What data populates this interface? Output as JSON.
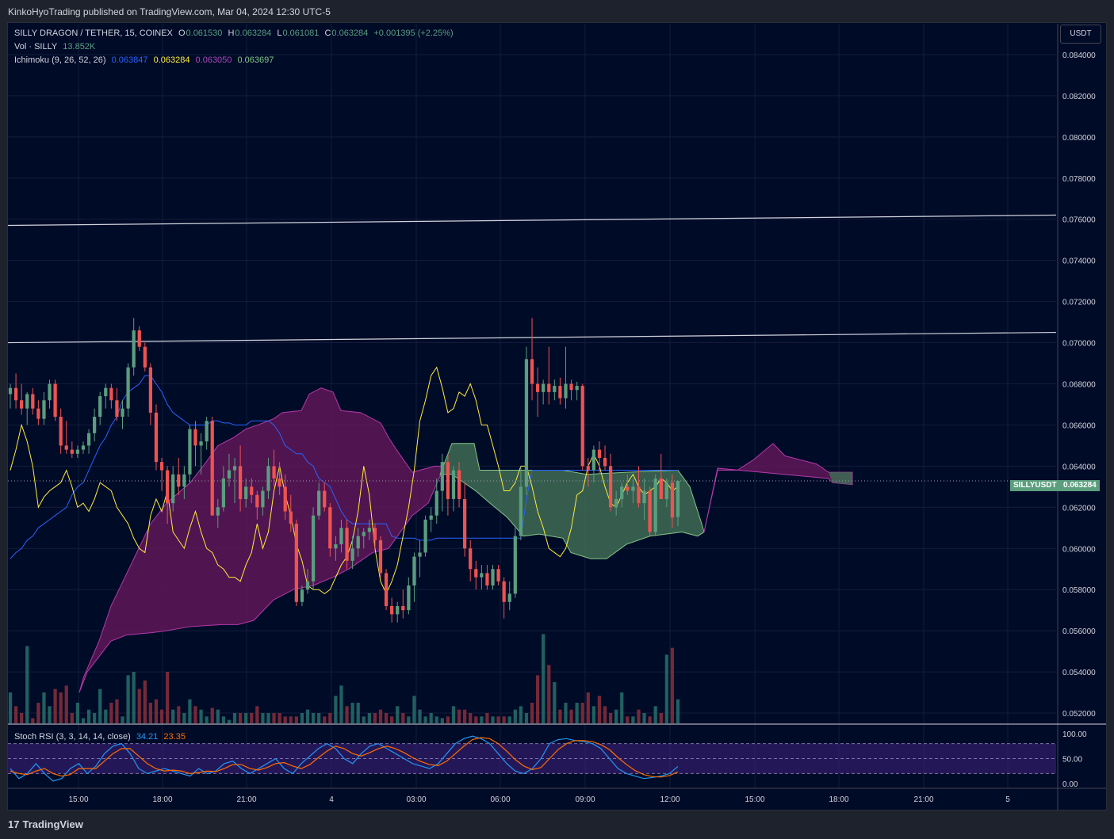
{
  "header": {
    "publisher_text": "KinkoHyoTrading published on TradingView.com, Mar 04, 2024 12:30 UTC-5"
  },
  "legend": {
    "symbol": "SILLY DRAGON / TETHER, 15, COINEX",
    "o_label": "O",
    "o": "0.061530",
    "h_label": "H",
    "h": "0.063284",
    "l_label": "L",
    "l": "0.061081",
    "c_label": "C",
    "c": "0.063284",
    "change": "+0.001395 (+2.25%)",
    "vol_label": "Vol · SILLY",
    "vol_value": "13.852K",
    "ichimoku_label": "Ichimoku (9, 26, 52, 26)",
    "ichimoku_values": [
      "0.063847",
      "0.063284",
      "0.063050",
      "0.063697"
    ],
    "ichimoku_colors": [
      "#2962ff",
      "#ffeb3b",
      "#ab47bc",
      "#81c784"
    ],
    "stoch_label": "Stoch RSI (3, 3, 14, 14, close)",
    "stoch_k": "34.21",
    "stoch_d": "23.35"
  },
  "axis": {
    "currency": "USDT",
    "symbol_tag": "SILLYUSDT",
    "last_price": "0.063284",
    "stoch_ticks": [
      "100.00",
      "50.00",
      "0.00"
    ]
  },
  "colors": {
    "up": "#5b9e7e",
    "down": "#ef5350",
    "background": "#000b28",
    "tenkan": "#2962ff",
    "kijun": "#ffeb3b",
    "cloud_bear": "#7b1f6e",
    "cloud_bull": "#3f6b55",
    "stoch_k": "#2196f3",
    "stoch_d": "#ff6d00"
  },
  "chart_data": {
    "type": "candlestick",
    "ylim": [
      0.0515,
      0.0855
    ],
    "y_ticks": [
      0.052,
      0.054,
      0.056,
      0.058,
      0.06,
      0.062,
      0.064,
      0.066,
      0.068,
      0.07,
      0.072,
      0.074,
      0.076,
      0.078,
      0.08,
      0.082,
      0.084
    ],
    "x_ticks": [
      "15:00",
      "18:00",
      "21:00",
      "4",
      "03:00",
      "06:00",
      "09:00",
      "12:00",
      "15:00",
      "18:00",
      "21:00",
      "5"
    ],
    "trendlines": [
      {
        "from": [
          0,
          0.0757
        ],
        "to": [
          1,
          0.0762
        ]
      },
      {
        "from": [
          0,
          0.07
        ],
        "to": [
          1,
          0.0705
        ]
      }
    ],
    "candles": [
      [
        0.0675,
        0.068,
        0.0668,
        0.0678
      ],
      [
        0.0678,
        0.0685,
        0.0668,
        0.0672
      ],
      [
        0.0672,
        0.068,
        0.0665,
        0.0668
      ],
      [
        0.0668,
        0.0676,
        0.066,
        0.0675
      ],
      [
        0.0675,
        0.0678,
        0.0665,
        0.0668
      ],
      [
        0.0668,
        0.0672,
        0.066,
        0.0663
      ],
      [
        0.0663,
        0.0676,
        0.066,
        0.0672
      ],
      [
        0.0672,
        0.0682,
        0.0668,
        0.068
      ],
      [
        0.068,
        0.0682,
        0.0662,
        0.0664
      ],
      [
        0.0664,
        0.0668,
        0.0646,
        0.065
      ],
      [
        0.065,
        0.0662,
        0.0646,
        0.0648
      ],
      [
        0.0648,
        0.0652,
        0.0644,
        0.0646
      ],
      [
        0.0646,
        0.065,
        0.0644,
        0.0648
      ],
      [
        0.0648,
        0.0652,
        0.0646,
        0.065
      ],
      [
        0.065,
        0.0658,
        0.0646,
        0.0656
      ],
      [
        0.0656,
        0.0668,
        0.0652,
        0.0664
      ],
      [
        0.0664,
        0.0676,
        0.066,
        0.0674
      ],
      [
        0.0674,
        0.068,
        0.0668,
        0.0678
      ],
      [
        0.0678,
        0.068,
        0.0668,
        0.0672
      ],
      [
        0.0672,
        0.0678,
        0.0662,
        0.0664
      ],
      [
        0.0664,
        0.0672,
        0.0658,
        0.0668
      ],
      [
        0.0668,
        0.069,
        0.0664,
        0.0688
      ],
      [
        0.0688,
        0.0712,
        0.0684,
        0.0706
      ],
      [
        0.0706,
        0.0708,
        0.0696,
        0.0698
      ],
      [
        0.0698,
        0.07,
        0.0686,
        0.0688
      ],
      [
        0.0688,
        0.069,
        0.066,
        0.0666
      ],
      [
        0.0666,
        0.067,
        0.0638,
        0.0642
      ],
      [
        0.0642,
        0.0644,
        0.0628,
        0.0638
      ],
      [
        0.0638,
        0.064,
        0.0612,
        0.0622
      ],
      [
        0.0622,
        0.064,
        0.0618,
        0.0636
      ],
      [
        0.0636,
        0.0644,
        0.0626,
        0.063
      ],
      [
        0.063,
        0.064,
        0.0624,
        0.0636
      ],
      [
        0.0636,
        0.066,
        0.0632,
        0.0658
      ],
      [
        0.0658,
        0.0662,
        0.064,
        0.065
      ],
      [
        0.065,
        0.0656,
        0.0636,
        0.0652
      ],
      [
        0.0652,
        0.0664,
        0.0648,
        0.0662
      ],
      [
        0.0662,
        0.0664,
        0.0618,
        0.0616
      ],
      [
        0.0616,
        0.0624,
        0.061,
        0.062
      ],
      [
        0.062,
        0.064,
        0.0618,
        0.0634
      ],
      [
        0.0634,
        0.0646,
        0.063,
        0.0638
      ],
      [
        0.0638,
        0.0644,
        0.0622,
        0.064
      ],
      [
        0.064,
        0.065,
        0.0618,
        0.0624
      ],
      [
        0.0624,
        0.0634,
        0.062,
        0.063
      ],
      [
        0.063,
        0.0634,
        0.0622,
        0.0626
      ],
      [
        0.0626,
        0.0628,
        0.0614,
        0.062
      ],
      [
        0.062,
        0.063,
        0.0616,
        0.0628
      ],
      [
        0.0628,
        0.0644,
        0.0624,
        0.064
      ],
      [
        0.064,
        0.0648,
        0.063,
        0.0634
      ],
      [
        0.0634,
        0.0642,
        0.0626,
        0.063
      ],
      [
        0.063,
        0.0636,
        0.0614,
        0.0618
      ],
      [
        0.0618,
        0.0626,
        0.0608,
        0.0612
      ],
      [
        0.0612,
        0.0614,
        0.0572,
        0.0574
      ],
      [
        0.0574,
        0.0582,
        0.0572,
        0.058
      ],
      [
        0.058,
        0.059,
        0.0578,
        0.0584
      ],
      [
        0.0584,
        0.062,
        0.058,
        0.0616
      ],
      [
        0.0616,
        0.0632,
        0.0614,
        0.0628
      ],
      [
        0.0628,
        0.0632,
        0.0618,
        0.062
      ],
      [
        0.062,
        0.0622,
        0.0596,
        0.06
      ],
      [
        0.06,
        0.0606,
        0.0594,
        0.0602
      ],
      [
        0.0602,
        0.0614,
        0.0598,
        0.061
      ],
      [
        0.061,
        0.0614,
        0.059,
        0.0594
      ],
      [
        0.0594,
        0.0606,
        0.059,
        0.06
      ],
      [
        0.06,
        0.061,
        0.0596,
        0.0606
      ],
      [
        0.0606,
        0.061,
        0.06,
        0.0608
      ],
      [
        0.0608,
        0.0614,
        0.0604,
        0.061
      ],
      [
        0.061,
        0.0612,
        0.06,
        0.0604
      ],
      [
        0.0604,
        0.0606,
        0.0586,
        0.0588
      ],
      [
        0.0588,
        0.059,
        0.057,
        0.0572
      ],
      [
        0.0572,
        0.0576,
        0.0564,
        0.0568
      ],
      [
        0.0568,
        0.0574,
        0.0564,
        0.0572
      ],
      [
        0.0572,
        0.058,
        0.0566,
        0.057
      ],
      [
        0.057,
        0.0586,
        0.0568,
        0.0582
      ],
      [
        0.0582,
        0.0598,
        0.0574,
        0.0596
      ],
      [
        0.0596,
        0.0604,
        0.0586,
        0.0598
      ],
      [
        0.0598,
        0.0616,
        0.0596,
        0.0614
      ],
      [
        0.0614,
        0.062,
        0.0608,
        0.0616
      ],
      [
        0.0616,
        0.0634,
        0.0612,
        0.0628
      ],
      [
        0.0628,
        0.0646,
        0.0618,
        0.0642
      ],
      [
        0.0642,
        0.0646,
        0.0616,
        0.0624
      ],
      [
        0.0624,
        0.064,
        0.0618,
        0.0638
      ],
      [
        0.0638,
        0.0642,
        0.062,
        0.0624
      ],
      [
        0.0624,
        0.0632,
        0.0596,
        0.06
      ],
      [
        0.06,
        0.0604,
        0.0584,
        0.059
      ],
      [
        0.059,
        0.0594,
        0.058,
        0.0586
      ],
      [
        0.0586,
        0.0592,
        0.058,
        0.0588
      ],
      [
        0.0588,
        0.0592,
        0.058,
        0.0582
      ],
      [
        0.0582,
        0.0592,
        0.058,
        0.059
      ],
      [
        0.059,
        0.0592,
        0.0582,
        0.0584
      ],
      [
        0.0584,
        0.0586,
        0.0566,
        0.0574
      ],
      [
        0.0574,
        0.0584,
        0.057,
        0.0578
      ],
      [
        0.0578,
        0.061,
        0.0576,
        0.0606
      ],
      [
        0.0606,
        0.064,
        0.0604,
        0.063
      ],
      [
        0.063,
        0.0698,
        0.0626,
        0.0692
      ],
      [
        0.0692,
        0.0712,
        0.0672,
        0.068
      ],
      [
        0.068,
        0.0688,
        0.0664,
        0.0676
      ],
      [
        0.0676,
        0.0682,
        0.067,
        0.068
      ],
      [
        0.068,
        0.0698,
        0.067,
        0.0676
      ],
      [
        0.0676,
        0.0682,
        0.0672,
        0.0679
      ],
      [
        0.0679,
        0.0683,
        0.067,
        0.0673
      ],
      [
        0.0673,
        0.0698,
        0.0668,
        0.068
      ],
      [
        0.068,
        0.0682,
        0.0672,
        0.0677
      ],
      [
        0.0677,
        0.0681,
        0.0672,
        0.0679
      ],
      [
        0.0679,
        0.068,
        0.0638,
        0.064
      ],
      [
        0.064,
        0.0644,
        0.063,
        0.0638
      ],
      [
        0.0638,
        0.065,
        0.0632,
        0.0648
      ],
      [
        0.0648,
        0.0652,
        0.0636,
        0.0644
      ],
      [
        0.0644,
        0.065,
        0.0638,
        0.064
      ],
      [
        0.064,
        0.0646,
        0.0618,
        0.062
      ],
      [
        0.062,
        0.0628,
        0.0616,
        0.0624
      ],
      [
        0.0624,
        0.0632,
        0.062,
        0.063
      ],
      [
        0.063,
        0.0636,
        0.0626,
        0.0628
      ],
      [
        0.0628,
        0.0634,
        0.0622,
        0.063
      ],
      [
        0.063,
        0.064,
        0.062,
        0.0622
      ],
      [
        0.0622,
        0.0634,
        0.0614,
        0.0628
      ],
      [
        0.0628,
        0.063,
        0.0606,
        0.0608
      ],
      [
        0.0608,
        0.0636,
        0.0606,
        0.0634
      ],
      [
        0.0634,
        0.0646,
        0.0628,
        0.0624
      ],
      [
        0.0624,
        0.0634,
        0.062,
        0.0632
      ],
      [
        0.0632,
        0.0636,
        0.061,
        0.0615
      ],
      [
        0.06153,
        0.063284,
        0.061081,
        0.063284
      ]
    ],
    "volume": [
      18,
      10,
      6,
      45,
      3,
      12,
      18,
      10,
      20,
      18,
      22,
      6,
      12,
      3,
      8,
      6,
      20,
      8,
      12,
      14,
      4,
      28,
      30,
      20,
      25,
      12,
      14,
      8,
      30,
      8,
      10,
      6,
      14,
      10,
      8,
      4,
      9,
      8,
      4,
      2,
      6,
      6,
      6,
      6,
      10,
      6,
      6,
      6,
      6,
      4,
      4,
      4,
      6,
      8,
      6,
      6,
      4,
      6,
      16,
      22,
      10,
      12,
      12,
      4,
      6,
      6,
      8,
      6,
      4,
      10,
      6,
      4,
      16,
      8,
      4,
      6,
      4,
      3,
      4,
      10,
      8,
      8,
      6,
      4,
      4,
      6,
      4,
      4,
      4,
      4,
      8,
      10,
      6,
      12,
      28,
      52,
      34,
      24,
      8,
      12,
      8,
      12,
      12,
      18,
      10,
      16,
      10,
      6,
      8,
      18,
      4,
      4,
      8,
      6,
      4,
      10,
      6,
      40,
      44,
      14
    ],
    "ichimoku": {
      "tenkan": [
        0.0595,
        0.0598,
        0.06,
        0.0604,
        0.0606,
        0.061,
        0.0612,
        0.0614,
        0.0616,
        0.0618,
        0.062,
        0.0626,
        0.063,
        0.0632,
        0.0638,
        0.0644,
        0.065,
        0.0654,
        0.066,
        0.0664,
        0.0672,
        0.0676,
        0.0678,
        0.068,
        0.0684,
        0.0684,
        0.068,
        0.0676,
        0.067,
        0.0666,
        0.0664,
        0.0662,
        0.066,
        0.066,
        0.066,
        0.066,
        0.0662,
        0.0662,
        0.0661,
        0.0661,
        0.066,
        0.066,
        0.066,
        0.0662,
        0.0662,
        0.0662,
        0.0662,
        0.066,
        0.0656,
        0.065,
        0.0648,
        0.0646,
        0.0646,
        0.0642,
        0.064,
        0.0634,
        0.0632,
        0.063,
        0.0624,
        0.0618,
        0.0614,
        0.0612,
        0.0612,
        0.0612,
        0.0612,
        0.0612,
        0.0612,
        0.0612,
        0.0606,
        0.0605,
        0.0605,
        0.0605,
        0.0605,
        0.0604,
        0.0604,
        0.0604,
        0.0605,
        0.0605,
        0.0605,
        0.0605,
        0.0605,
        0.0605,
        0.0605,
        0.0605,
        0.0605,
        0.0605,
        0.0605,
        0.0605,
        0.0605,
        0.0605,
        0.0605,
        0.0605,
        0.0624,
        0.0638,
        0.0638,
        0.0638,
        0.0638,
        0.0638,
        0.0638,
        0.0638,
        0.0638,
        0.0638,
        0.0638,
        0.0638,
        0.0638,
        0.0638,
        0.0638,
        0.0638,
        0.0638,
        0.0638,
        0.0638,
        0.0638,
        0.0638,
        0.0638,
        0.0638,
        0.0638,
        0.0638,
        0.0638,
        0.0638,
        0.0638
      ],
      "kijun": [
        0.0638,
        0.0648,
        0.066,
        0.0652,
        0.064,
        0.062,
        0.0625,
        0.0628,
        0.063,
        0.0632,
        0.0638,
        0.063,
        0.062,
        0.0622,
        0.0618,
        0.0624,
        0.0632,
        0.063,
        0.0628,
        0.062,
        0.0616,
        0.0612,
        0.0605,
        0.06,
        0.0598,
        0.0616,
        0.0624,
        0.0618,
        0.0628,
        0.0608,
        0.0604,
        0.06,
        0.061,
        0.0618,
        0.0608,
        0.06,
        0.0598,
        0.0592,
        0.059,
        0.0586,
        0.0586,
        0.0584,
        0.0592,
        0.0598,
        0.0612,
        0.06,
        0.0608,
        0.0628,
        0.064,
        0.0626,
        0.0616,
        0.0602,
        0.0594,
        0.0582,
        0.058,
        0.058,
        0.0578,
        0.058,
        0.0586,
        0.0592,
        0.0596,
        0.0604,
        0.0618,
        0.064,
        0.0626,
        0.06,
        0.0584,
        0.0578,
        0.0584,
        0.0592,
        0.0606,
        0.062,
        0.0638,
        0.0662,
        0.0672,
        0.0684,
        0.0688,
        0.0678,
        0.0666,
        0.0668,
        0.0676,
        0.0674,
        0.068,
        0.0672,
        0.066,
        0.066,
        0.065,
        0.064,
        0.0628,
        0.0628,
        0.0632,
        0.064,
        0.064,
        0.063,
        0.0618,
        0.061,
        0.06,
        0.0598,
        0.0596,
        0.06,
        0.061,
        0.0626,
        0.0628,
        0.064,
        0.0646,
        0.064,
        0.063,
        0.0622,
        0.062,
        0.0626,
        0.0632,
        0.0636,
        0.063,
        0.0626,
        0.0628,
        0.063,
        0.0634,
        0.0632,
        0.0628,
        0.063
      ]
    },
    "stoch_rsi": {
      "k": [
        30,
        10,
        20,
        40,
        20,
        5,
        10,
        30,
        40,
        20,
        35,
        60,
        75,
        80,
        60,
        30,
        20,
        25,
        30,
        25,
        20,
        15,
        30,
        20,
        25,
        40,
        45,
        30,
        20,
        30,
        40,
        50,
        30,
        20,
        40,
        55,
        70,
        80,
        70,
        50,
        40,
        60,
        75,
        80,
        70,
        60,
        50,
        40,
        35,
        30,
        40,
        60,
        80,
        90,
        95,
        90,
        80,
        60,
        40,
        25,
        20,
        30,
        50,
        80,
        88,
        90,
        86,
        84,
        80,
        70,
        50,
        30,
        20,
        15,
        10,
        12,
        15,
        20,
        34.21
      ],
      "d": [
        25,
        20,
        18,
        25,
        30,
        20,
        15,
        18,
        30,
        30,
        30,
        45,
        60,
        70,
        70,
        55,
        40,
        30,
        25,
        27,
        25,
        20,
        22,
        25,
        24,
        30,
        38,
        38,
        30,
        27,
        32,
        40,
        42,
        35,
        30,
        38,
        52,
        65,
        75,
        70,
        60,
        55,
        62,
        70,
        75,
        70,
        62,
        52,
        44,
        38,
        36,
        45,
        60,
        75,
        88,
        92,
        90,
        80,
        65,
        48,
        35,
        28,
        32,
        50,
        68,
        80,
        86,
        86,
        84,
        78,
        68,
        52,
        38,
        26,
        18,
        14,
        13,
        16,
        23.35
      ]
    }
  }
}
